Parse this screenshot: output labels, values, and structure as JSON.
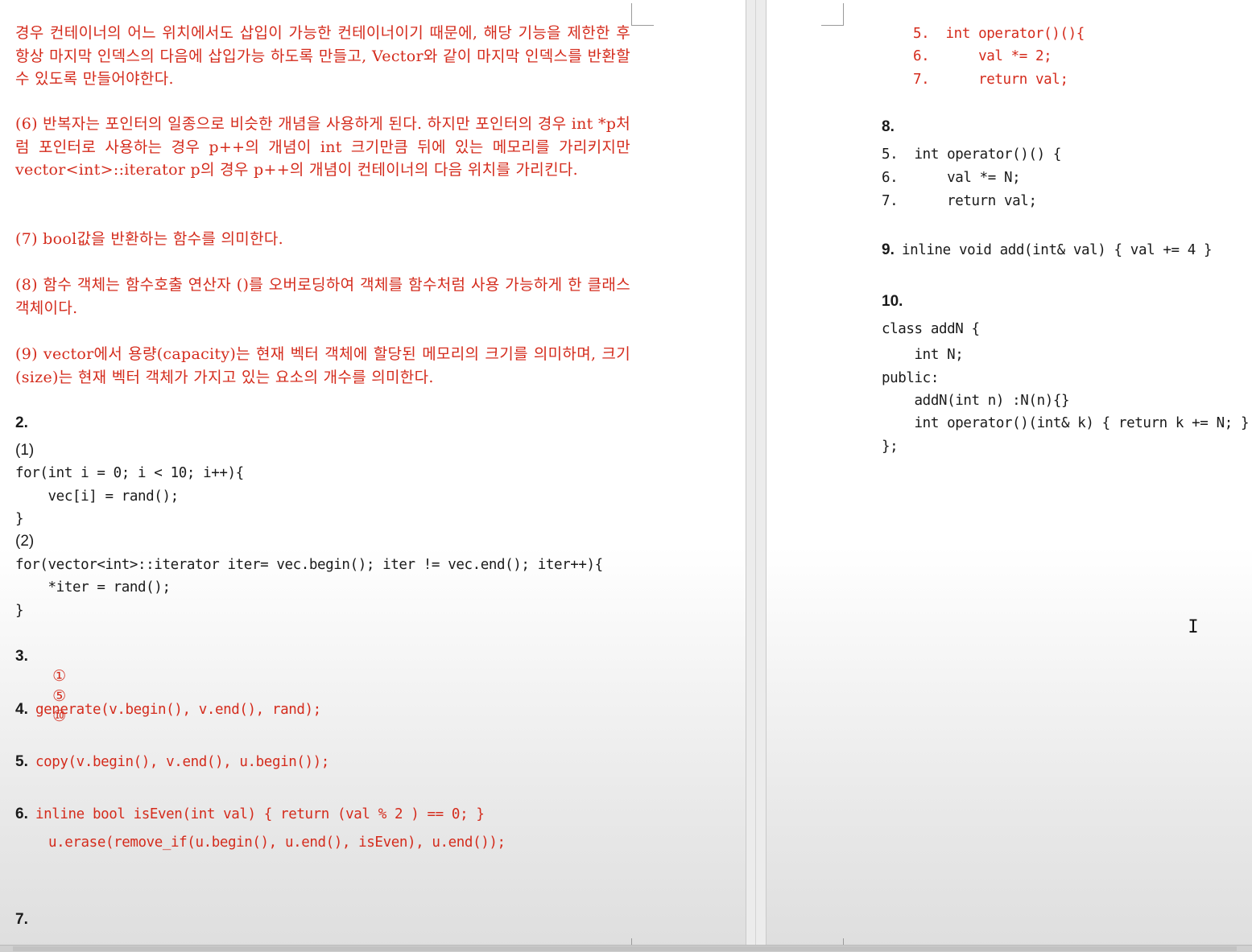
{
  "left": {
    "paragraphs": [
      "경우 컨테이너의 어느 위치에서도 삽입이 가능한 컨테이너이기 때문에, 해당 기능을 제한한 후 항상 마지막 인덱스의 다음에 삽입가능 하도록 만들고, Vector와 같이 마지막 인덱스를 반환할 수 있도록 만들어야한다.",
      "(6) 반복자는 포인터의 일종으로 비슷한 개념을 사용하게 된다. 하지만 포인터의 경우 int *p처럼 포인터로 사용하는 경우 p++의 개념이 int 크기만큼 뒤에 있는 메모리를 가리키지만 vector<int>::iterator p의 경우 p++의 개념이 컨테이너의 다음 위치를 가리킨다.",
      "(7) bool값을 반환하는 함수를 의미한다.",
      "(8) 함수 객체는 함수호출 연산자 ()를 오버로딩하여 객체를 함수처럼 사용 가능하게 한 클래스 객체이다.",
      "(9) vector에서 용량(capacity)는 현재 벡터 객체에 할당된 메모리의 크기를 의미하며, 크기(size)는 현재 벡터 객체가 가지고 있는 요소의 개수를 의미한다."
    ],
    "q2": {
      "label": "2.",
      "sub1": "(1)",
      "code1": [
        "for(int i = 0; i < 10; i++){",
        "    vec[i] = rand();",
        "}"
      ],
      "sub2": "(2)",
      "code2": [
        "for(vector<int>::iterator iter= vec.begin(); iter != vec.end(); iter++){",
        "    *iter = rand();",
        "}"
      ]
    },
    "q3": {
      "label": "3.",
      "answers": [
        "①",
        "⑤",
        "⑩"
      ]
    },
    "q4": {
      "label": "4.",
      "code": "generate(v.begin(), v.end(), rand);"
    },
    "q5": {
      "label": "5.",
      "code": "copy(v.begin(), v.end(), u.begin());"
    },
    "q6": {
      "label": "6.",
      "code1": "inline bool isEven(int val) { return (val % 2 ) == 0; }",
      "code2": "u.erase(remove_if(u.begin(), u.end(), isEven), u.end());"
    },
    "q7": {
      "label": "7."
    }
  },
  "right": {
    "q7_cont": [
      "5.  int operator()(){",
      "6.      val *= 2;",
      "7.      return val;"
    ],
    "q8": {
      "label": "8.",
      "code": [
        "5.  int operator()() {",
        "6.      val *= N;",
        "7.      return val;"
      ]
    },
    "q9": {
      "label": "9.",
      "code": "inline void add(int& val) { val += 4 }"
    },
    "q10": {
      "label": "10.",
      "code": [
        "class addN {",
        "    int N;",
        "public:",
        "    addN(int n) :N(n){}",
        "    int operator()(int& k) { return k += N; }",
        "};"
      ]
    }
  },
  "colors": {
    "korean_text": "#d42b1c",
    "question_number": "#1f3c9e",
    "code_text": "#1a1a1a"
  }
}
